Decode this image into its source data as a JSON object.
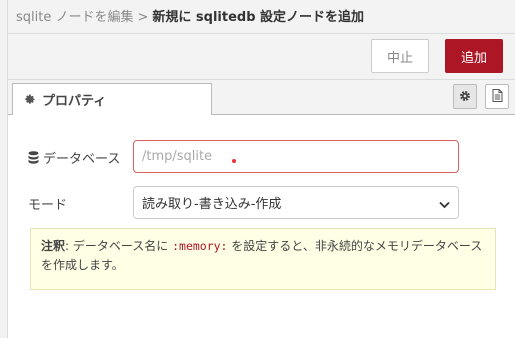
{
  "header": {
    "parent": "sqlite ノードを編集",
    "separator": ">",
    "current": "新規に sqlitedb 設定ノードを追加"
  },
  "toolbar": {
    "cancel_label": "中止",
    "add_label": "追加"
  },
  "tabs": {
    "properties_label": "プロパティ"
  },
  "form": {
    "database": {
      "label": "データベース",
      "placeholder": "/tmp/sqlite"
    },
    "mode": {
      "label": "モード",
      "selected": "読み取り-書き込み-作成"
    }
  },
  "note": {
    "prefix": "注釈",
    "colon": ": ",
    "text_before": "データベース名に ",
    "code": ":memory:",
    "text_after": " を設定すると、非永続的なメモリデータベースを作成します。"
  },
  "colors": {
    "accent": "#ad1625",
    "error_border": "#d6615e",
    "note_bg": "#ffffe6"
  }
}
